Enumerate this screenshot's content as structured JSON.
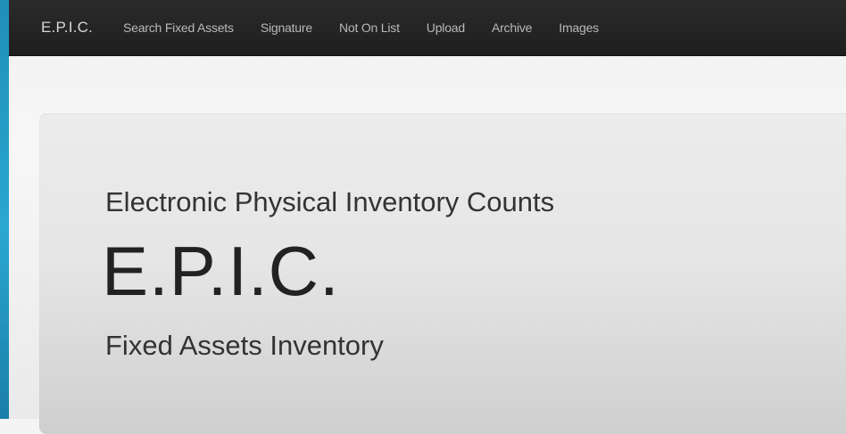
{
  "navbar": {
    "brand": "E.P.I.C.",
    "links": [
      {
        "label": "Search Fixed Assets"
      },
      {
        "label": "Signature"
      },
      {
        "label": "Not On List"
      },
      {
        "label": "Upload"
      },
      {
        "label": "Archive"
      },
      {
        "label": "Images"
      }
    ]
  },
  "hero": {
    "subtitle_top": "Electronic Physical Inventory Counts",
    "title": "E.P.I.C.",
    "subtitle_bottom": "Fixed Assets Inventory"
  },
  "colors": {
    "navbar_bg": "#222222",
    "nav_text": "#b9b9b9",
    "brand_text": "#d8d8d8",
    "left_accent": "#2aa7d1",
    "hero_bg": "#e6e6e6"
  }
}
